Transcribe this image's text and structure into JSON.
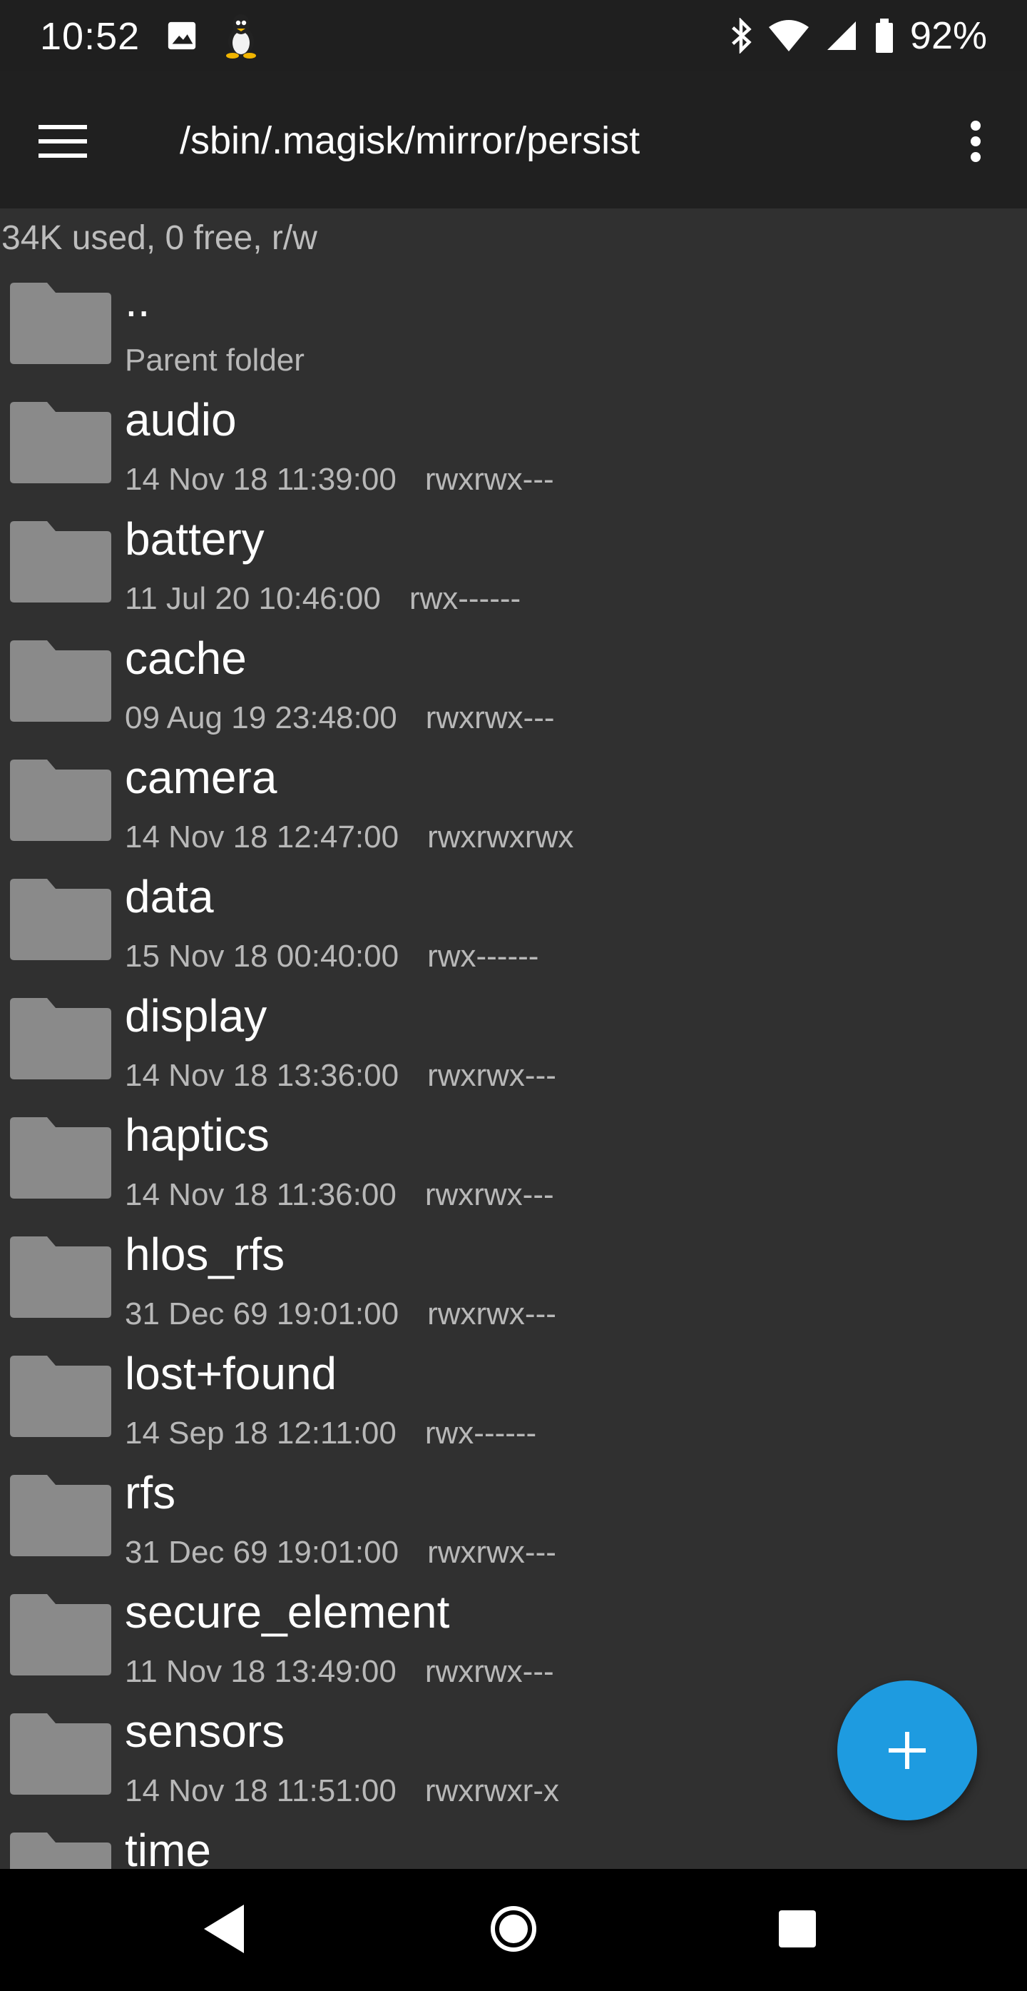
{
  "status_bar": {
    "time": "10:52",
    "battery": "92%",
    "icons": [
      "image-icon",
      "linux-tux-icon",
      "bluetooth-icon",
      "wifi-icon",
      "signal-icon",
      "battery-icon"
    ]
  },
  "app_bar": {
    "path": "/sbin/.magisk/mirror/persist",
    "menu_icon": "hamburger-menu-icon",
    "overflow_icon": "more-vert-icon"
  },
  "storage_info": "34K used, 0 free, r/w",
  "parent": {
    "name": "..",
    "label": "Parent folder"
  },
  "folders": [
    {
      "name": "audio",
      "date": "14 Nov 18 11:39:00",
      "perm": "rwxrwx---"
    },
    {
      "name": "battery",
      "date": "11 Jul 20 10:46:00",
      "perm": "rwx------"
    },
    {
      "name": "cache",
      "date": "09 Aug 19 23:48:00",
      "perm": "rwxrwx---"
    },
    {
      "name": "camera",
      "date": "14 Nov 18 12:47:00",
      "perm": "rwxrwxrwx"
    },
    {
      "name": "data",
      "date": "15 Nov 18 00:40:00",
      "perm": "rwx------"
    },
    {
      "name": "display",
      "date": "14 Nov 18 13:36:00",
      "perm": "rwxrwx---"
    },
    {
      "name": "haptics",
      "date": "14 Nov 18 11:36:00",
      "perm": "rwxrwx---"
    },
    {
      "name": "hlos_rfs",
      "date": "31 Dec 69 19:01:00",
      "perm": "rwxrwx---"
    },
    {
      "name": "lost+found",
      "date": "14 Sep 18 12:11:00",
      "perm": "rwx------"
    },
    {
      "name": "rfs",
      "date": "31 Dec 69 19:01:00",
      "perm": "rwxrwx---"
    },
    {
      "name": "secure_element",
      "date": "11 Nov 18 13:49:00",
      "perm": "rwxrwx---"
    },
    {
      "name": "sensors",
      "date": "14 Nov 18 11:51:00",
      "perm": "rwxrwxr-x"
    },
    {
      "name": "time",
      "date": "",
      "perm": ""
    }
  ],
  "fab": {
    "icon": "plus-icon"
  },
  "nav_bar": {
    "icons": [
      "back-icon",
      "home-icon",
      "recents-icon"
    ]
  },
  "colors": {
    "accent": "#1e9be0",
    "background": "#303030",
    "app_bar": "#202020",
    "folder": "#8a8a8a"
  }
}
